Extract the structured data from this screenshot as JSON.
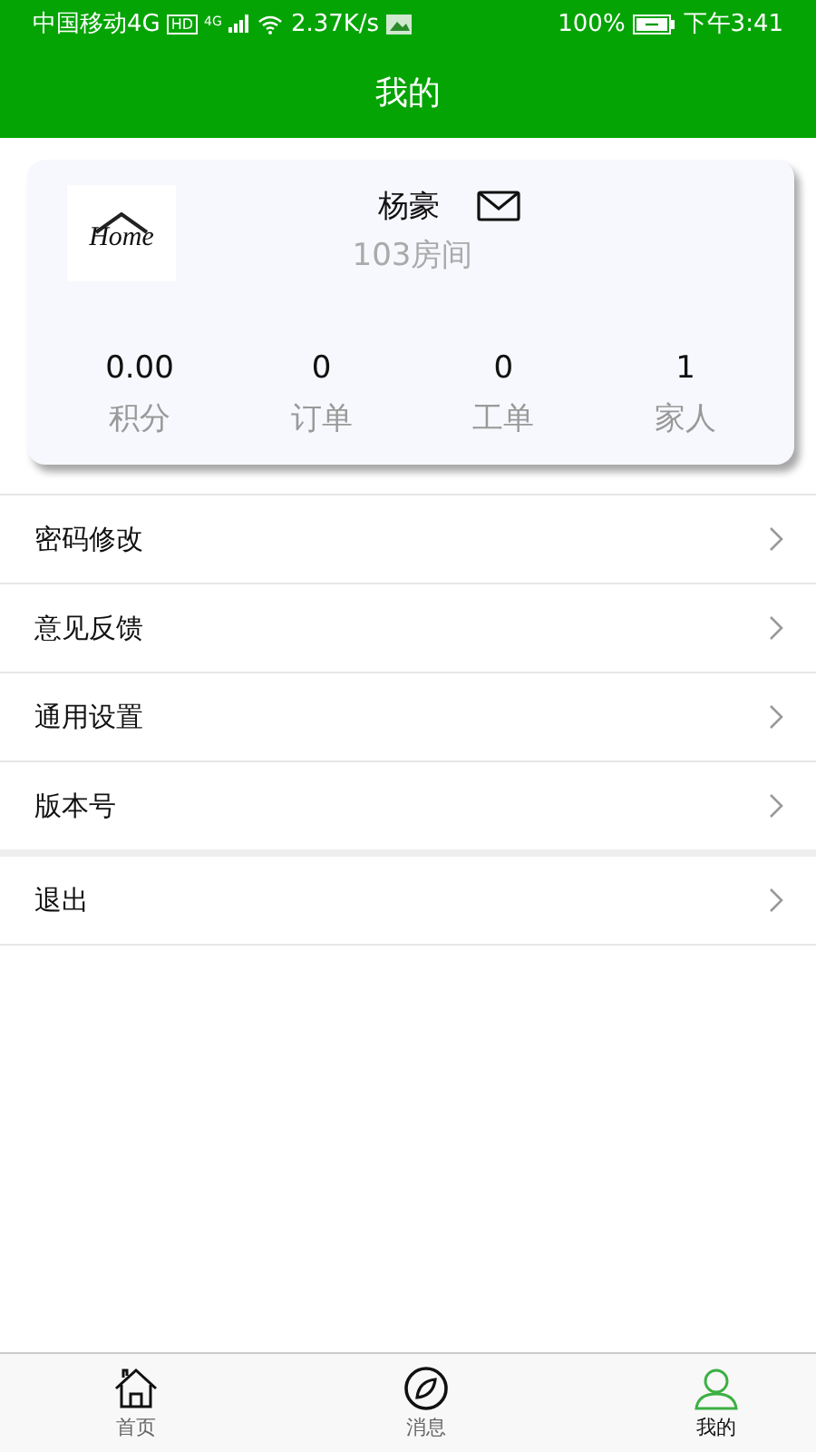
{
  "status_bar": {
    "carrier": "中国移动4G",
    "network_badge": "HD",
    "signal_label": "4G",
    "speed": "2.37K/s",
    "battery": "100%",
    "time": "下午3:41"
  },
  "header": {
    "title": "我的"
  },
  "profile": {
    "logo_text": "Home",
    "name": "杨豪",
    "room": "103房间",
    "stats": [
      {
        "value": "0.00",
        "label": "积分"
      },
      {
        "value": "0",
        "label": "订单"
      },
      {
        "value": "0",
        "label": "工单"
      },
      {
        "value": "1",
        "label": "家人"
      }
    ]
  },
  "menu": [
    {
      "label": "密码修改"
    },
    {
      "label": "意见反馈"
    },
    {
      "label": "通用设置"
    },
    {
      "label": "版本号"
    },
    {
      "label": "退出"
    }
  ],
  "tabs": [
    {
      "label": "首页",
      "kind": "home",
      "selected": false
    },
    {
      "label": "消息",
      "kind": "compass",
      "selected": false
    },
    {
      "label": "我的",
      "kind": "person",
      "selected": true
    }
  ]
}
